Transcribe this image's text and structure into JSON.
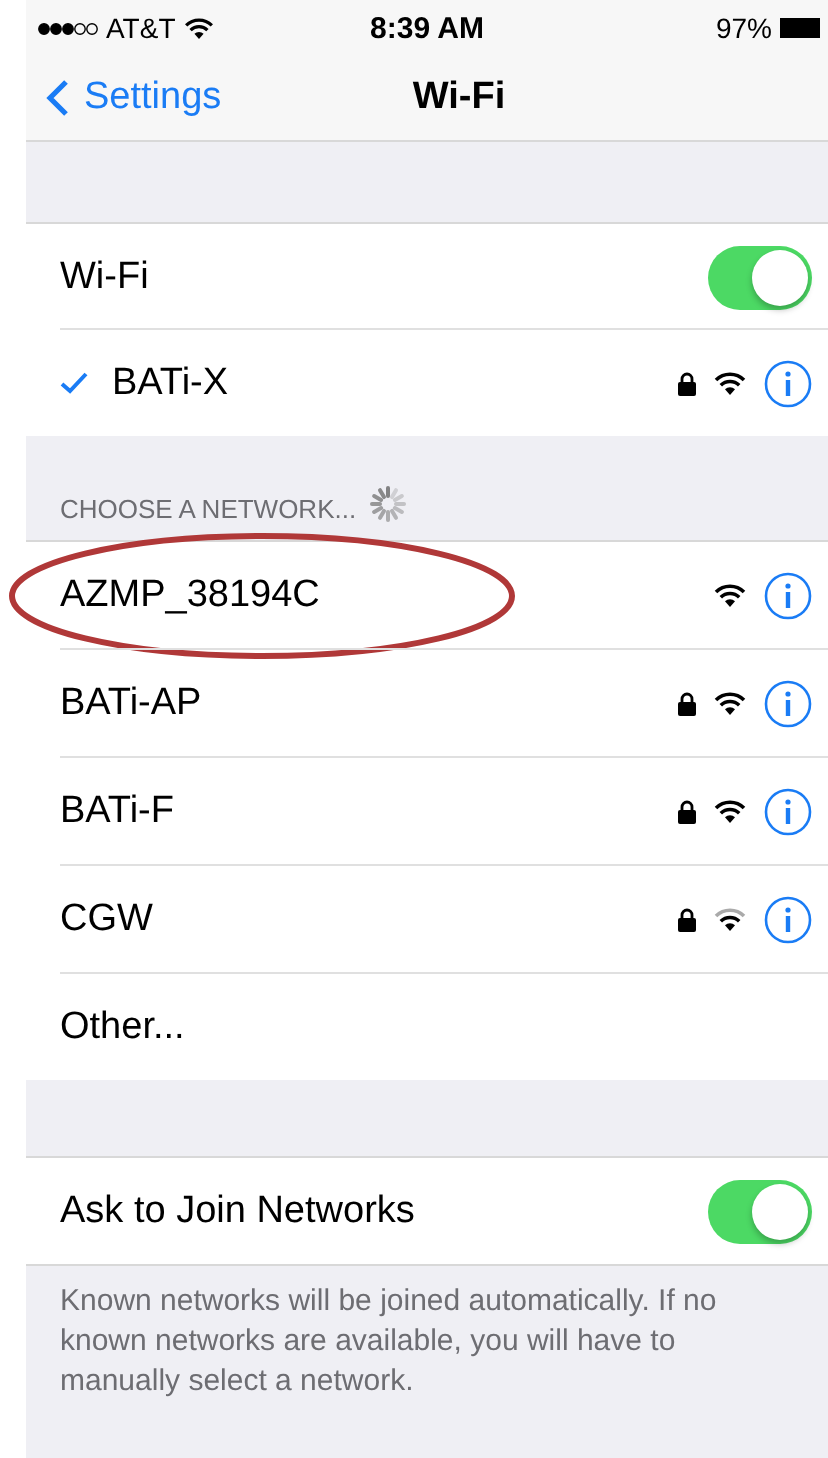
{
  "status_bar": {
    "carrier": "AT&T",
    "time": "8:39 AM",
    "battery": "97%"
  },
  "nav": {
    "back": "Settings",
    "title": "Wi-Fi"
  },
  "wifi": {
    "label": "Wi-Fi",
    "on": true
  },
  "connected": {
    "name": "BATi-X",
    "locked": true,
    "weak_signal": false
  },
  "choose": {
    "header": "CHOOSE A NETWORK...",
    "scanning": true
  },
  "networks": [
    {
      "name": "AZMP_38194C",
      "locked": false,
      "weak_signal": false,
      "highlighted": true
    },
    {
      "name": "BATi-AP",
      "locked": true,
      "weak_signal": false,
      "highlighted": false
    },
    {
      "name": "BATi-F",
      "locked": true,
      "weak_signal": false,
      "highlighted": false
    },
    {
      "name": "CGW",
      "locked": true,
      "weak_signal": true,
      "highlighted": false
    }
  ],
  "other": "Other...",
  "ask": {
    "label": "Ask to Join Networks",
    "on": true,
    "footer": "Known networks will be joined automatically. If no known networks are available, you will have to manually select a network."
  }
}
